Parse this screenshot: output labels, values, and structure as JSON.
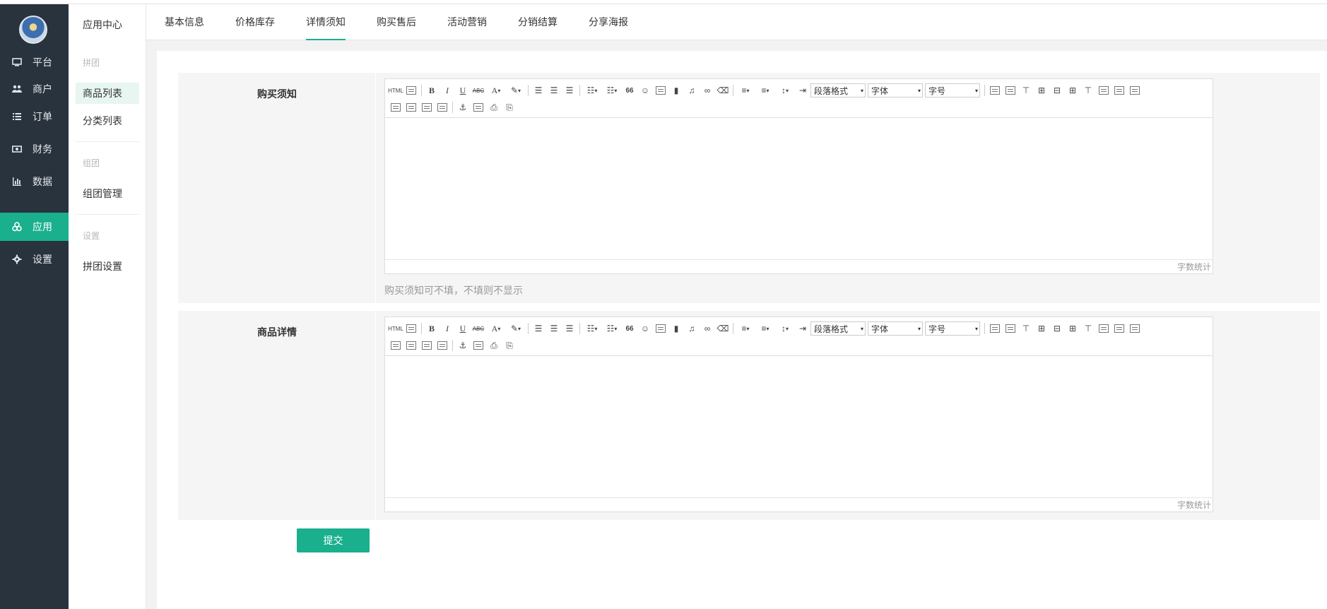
{
  "sidebar": {
    "items": [
      {
        "label": "平台",
        "icon": "monitor-icon"
      },
      {
        "label": "商户",
        "icon": "users-icon"
      },
      {
        "label": "订单",
        "icon": "list-icon"
      },
      {
        "label": "财务",
        "icon": "money-icon"
      },
      {
        "label": "数据",
        "icon": "bar-chart-icon"
      },
      {
        "label": "应用",
        "icon": "apps-icon",
        "active": true
      },
      {
        "label": "设置",
        "icon": "gear-icon"
      }
    ],
    "active_color": "#1aaf8d"
  },
  "subsidebar": {
    "title": "应用中心",
    "group1": "拼团",
    "item_goods_list": "商品列表",
    "item_category_list": "分类列表",
    "group2": "组团",
    "item_group_manage": "组团管理",
    "group3": "设置",
    "item_group_settings": "拼团设置"
  },
  "tabs": [
    "基本信息",
    "价格库存",
    "详情须知",
    "购买售后",
    "活动营销",
    "分销结算",
    "分享海报"
  ],
  "active_tab": "详情须知",
  "form": {
    "purchase_notice": {
      "label": "购买须知",
      "wordcount": "字数统计",
      "tip": "购买须知可不填，不填则不显示"
    },
    "product_detail": {
      "label": "商品详情",
      "wordcount": "字数统计"
    },
    "submit_label": "提交"
  },
  "editor_toolbar": {
    "html_label": "HTML",
    "bold": "B",
    "italic": "I",
    "underline": "U",
    "strike": "ABC",
    "font_color": "A",
    "quote": "66",
    "paragraph_select": "段落格式",
    "font_select": "字体",
    "size_select": "字号"
  }
}
